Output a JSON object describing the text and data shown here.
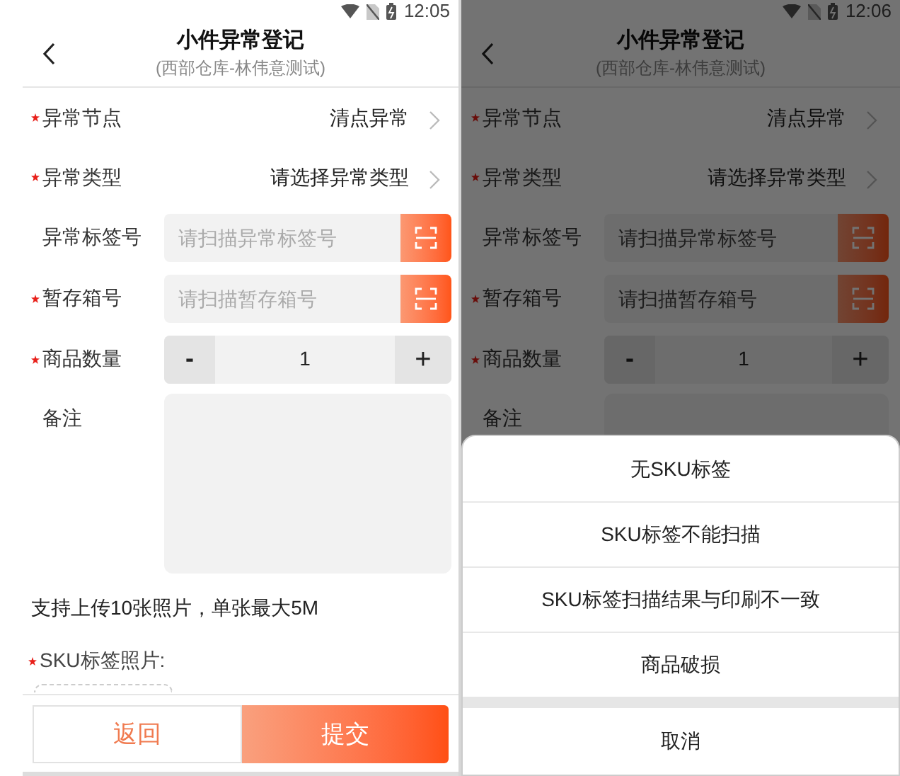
{
  "screens": [
    {
      "status_time": "12:05",
      "title": "小件异常登记",
      "subtitle": "(西部仓库-林伟意测试)",
      "fields": [
        {
          "kind": "select",
          "label": "异常节点",
          "required": true,
          "value": "清点异常"
        },
        {
          "kind": "select",
          "label": "异常类型",
          "required": true,
          "value": "请选择异常类型"
        },
        {
          "kind": "scan",
          "label": "异常标签号",
          "required": false,
          "placeholder": "请扫描异常标签号"
        },
        {
          "kind": "scan",
          "label": "暂存箱号",
          "required": true,
          "placeholder": "请扫描暂存箱号"
        },
        {
          "kind": "stepper",
          "label": "商品数量",
          "required": true,
          "minus": "-",
          "value": "1",
          "plus": "+"
        },
        {
          "kind": "textarea",
          "label": "备注",
          "required": false
        }
      ],
      "upload_note": "支持上传10张照片，单张最大5M",
      "photo_label": {
        "text": "SKU标签照片:",
        "required": true
      },
      "buttons": [
        {
          "kind": "secondary",
          "label": "返回"
        },
        {
          "kind": "primary",
          "label": "提交"
        }
      ]
    },
    {
      "status_time": "12:06",
      "title": "小件异常登记",
      "subtitle": "(西部仓库-林伟意测试)",
      "fields": [
        {
          "kind": "select",
          "label": "异常节点",
          "required": true,
          "value": "清点异常"
        },
        {
          "kind": "select",
          "label": "异常类型",
          "required": true,
          "value": "请选择异常类型"
        },
        {
          "kind": "scan",
          "label": "异常标签号",
          "required": false,
          "placeholder": "请扫描异常标签号"
        },
        {
          "kind": "scan",
          "label": "暂存箱号",
          "required": true,
          "placeholder": "请扫描暂存箱号"
        },
        {
          "kind": "stepper",
          "label": "商品数量",
          "required": true,
          "minus": "-",
          "value": "1",
          "plus": "+"
        },
        {
          "kind": "textarea",
          "label": "备注",
          "required": false
        }
      ],
      "action_sheet": {
        "options": [
          "无SKU标签",
          "SKU标签不能扫描",
          "SKU标签扫描结果与印刷不一致",
          "商品破损"
        ],
        "cancel": "取消"
      }
    }
  ]
}
